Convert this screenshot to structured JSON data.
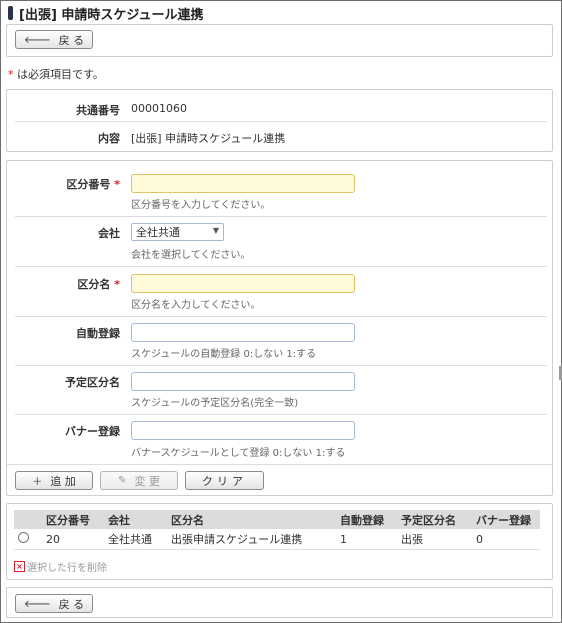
{
  "page": {
    "title": "[出張] 申請時スケジュール連携"
  },
  "buttons": {
    "back": "戻 る",
    "add": "追 加",
    "edit": "変 更",
    "clear": "クリア"
  },
  "required_note": {
    "mark": "*",
    "text": " は必須項目です。"
  },
  "info": {
    "common_no_label": "共通番号",
    "common_no_value": "00001060",
    "content_label": "内容",
    "content_value": "[出張] 申請時スケジュール連携"
  },
  "form": {
    "fields": [
      {
        "label": "区分番号",
        "required": true,
        "hint": "区分番号を入力してください。",
        "value": ""
      },
      {
        "label": "会社",
        "required": false,
        "hint": "会社を選択してください。",
        "value": "全社共通"
      },
      {
        "label": "区分名",
        "required": true,
        "hint": "区分名を入力してください。",
        "value": ""
      },
      {
        "label": "自動登録",
        "required": false,
        "hint": "スケジュールの自動登録 0:しない 1:する",
        "value": ""
      },
      {
        "label": "予定区分名",
        "required": false,
        "hint": "スケジュールの予定区分名(完全一致)",
        "value": ""
      },
      {
        "label": "バナー登録",
        "required": false,
        "hint": "バナースケジュールとして登録 0:しない 1:する",
        "value": ""
      }
    ]
  },
  "table": {
    "columns": [
      "区分番号",
      "会社",
      "区分名",
      "自動登録",
      "予定区分名",
      "バナー登録"
    ],
    "rows": [
      {
        "no": "20",
        "company": "全社共通",
        "name": "出張申請スケジュール連携",
        "auto": "1",
        "type": "出張",
        "banner": "0"
      }
    ]
  },
  "delete_selected": "選択した行を削除"
}
